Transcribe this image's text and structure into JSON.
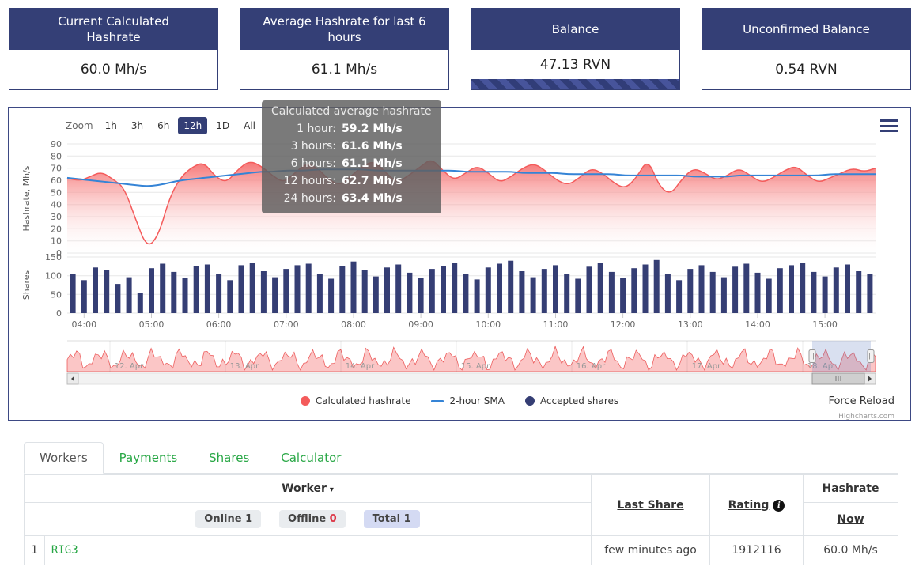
{
  "cards": [
    {
      "title": "Current Calculated Hashrate",
      "value": "60.0 Mh/s"
    },
    {
      "title": "Average Hashrate for last 6 hours",
      "value": "61.1 Mh/s"
    },
    {
      "title": "Balance",
      "value": "47.13 RVN"
    },
    {
      "title": "Unconfirmed Balance",
      "value": "0.54 RVN"
    }
  ],
  "tooltip": {
    "title": "Calculated average hashrate",
    "rows": [
      {
        "label": "1 hour:",
        "value": "59.2 Mh/s"
      },
      {
        "label": "3 hours:",
        "value": "61.6 Mh/s"
      },
      {
        "label": "6 hours:",
        "value": "61.1 Mh/s"
      },
      {
        "label": "12 hours:",
        "value": "62.7 Mh/s"
      },
      {
        "label": "24 hours:",
        "value": "63.4 Mh/s"
      }
    ]
  },
  "chart": {
    "zoom_label": "Zoom",
    "zoom_buttons": [
      "1h",
      "3h",
      "6h",
      "12h",
      "1D",
      "All"
    ],
    "active_zoom": "12h",
    "legend": [
      {
        "label": "Calculated hashrate",
        "marker": "circle",
        "color": "#f45b5b"
      },
      {
        "label": "2-hour SMA",
        "marker": "line",
        "color": "#3584d6"
      },
      {
        "label": "Accepted shares",
        "marker": "circle",
        "color": "#353e74"
      }
    ],
    "force_reload": "Force Reload",
    "credit": "Highcharts.com"
  },
  "chart_data": {
    "type": "mixed",
    "x_labels": [
      "04:00",
      "05:00",
      "06:00",
      "07:00",
      "08:00",
      "09:00",
      "10:00",
      "11:00",
      "12:00",
      "13:00",
      "14:00",
      "15:00"
    ],
    "panels": [
      {
        "name": "hashrate",
        "type": "area+line",
        "ylabel": "Hashrate, Mh/s",
        "ylim": [
          0,
          90
        ],
        "yticks": [
          0,
          10,
          20,
          30,
          40,
          50,
          60,
          70,
          80,
          90
        ],
        "series": [
          {
            "name": "Calculated hashrate",
            "color": "#f45b5b",
            "values": [
              62,
              59,
              63,
              67,
              61,
              54,
              28,
              4,
              14,
              46,
              63,
              71,
              75,
              63,
              58,
              69,
              76,
              72,
              64,
              58,
              66,
              74,
              70,
              60,
              56,
              64,
              72,
              76,
              66,
              58,
              64,
              71,
              78,
              68,
              60,
              66,
              72,
              66,
              58,
              63,
              70,
              74,
              68,
              60,
              56,
              62,
              70,
              66,
              58,
              53,
              62,
              78,
              55,
              48,
              61,
              70,
              66,
              60,
              64,
              70,
              64,
              58,
              62,
              68,
              72,
              64,
              58,
              62,
              66,
              70,
              67,
              70
            ]
          },
          {
            "name": "2-hour SMA",
            "color": "#3584d6",
            "values": [
              62,
              61,
              60,
              59,
              58,
              57,
              56,
              55,
              56,
              58,
              60,
              61,
              62,
              63,
              64,
              65,
              66,
              67,
              67,
              68,
              68,
              68,
              69,
              69,
              69,
              69,
              69,
              68,
              68,
              68,
              68,
              68,
              68,
              68,
              68,
              67,
              67,
              67,
              67,
              67,
              66,
              66,
              66,
              66,
              65,
              65,
              65,
              65,
              65,
              64,
              64,
              64,
              64,
              64,
              64,
              63,
              63,
              63,
              63,
              64,
              64,
              64,
              64,
              64,
              64,
              64,
              64,
              65,
              65,
              65,
              65,
              65
            ]
          }
        ]
      },
      {
        "name": "shares",
        "type": "bar",
        "ylabel": "Shares",
        "ylim": [
          0,
          150
        ],
        "yticks": [
          0,
          50,
          100,
          150
        ],
        "series": [
          {
            "name": "Accepted shares",
            "color": "#353e74",
            "values": [
              105,
              88,
              122,
              115,
              78,
              96,
              54,
              120,
              132,
              110,
              95,
              125,
              130,
              105,
              88,
              128,
              135,
              112,
              96,
              118,
              128,
              132,
              105,
              92,
              125,
              138,
              115,
              98,
              122,
              130,
              108,
              94,
              118,
              126,
              135,
              105,
              90,
              122,
              132,
              140,
              112,
              96,
              118,
              128,
              105,
              92,
              124,
              134,
              110,
              95,
              120,
              130,
              142,
              105,
              88,
              118,
              128,
              110,
              96,
              124,
              132,
              108,
              92,
              120,
              128,
              135,
              110,
              98,
              122,
              130,
              112,
              105
            ]
          }
        ]
      }
    ],
    "navigator": {
      "labels": [
        "12. Apr",
        "13. Apr",
        "14. Apr",
        "15. Apr",
        "16. Apr",
        "17. Apr",
        "18. Apr"
      ],
      "selected": "12h window at right end"
    }
  },
  "tabs": [
    {
      "label": "Workers",
      "active": true
    },
    {
      "label": "Payments",
      "active": false
    },
    {
      "label": "Shares",
      "active": false
    },
    {
      "label": "Calculator",
      "active": false
    }
  ],
  "table": {
    "headers": {
      "worker": "Worker",
      "last_share": "Last Share",
      "rating": "Rating",
      "hashrate": "Hashrate",
      "now": "Now"
    },
    "filters": [
      {
        "label": "Online",
        "count": "1"
      },
      {
        "label": "Offline",
        "count": "0"
      },
      {
        "label": "Total",
        "count": "1"
      }
    ],
    "rows": [
      {
        "index": "1",
        "worker": "RIG3",
        "last_share": "few minutes ago",
        "rating": "1912116",
        "hashrate_now": "60.0 Mh/s"
      }
    ]
  },
  "theme": {
    "navy": "#343f76",
    "green": "#28a745",
    "red": "#dc3545",
    "chart_red": "#f45b5b",
    "chart_blue": "#3584d6"
  }
}
